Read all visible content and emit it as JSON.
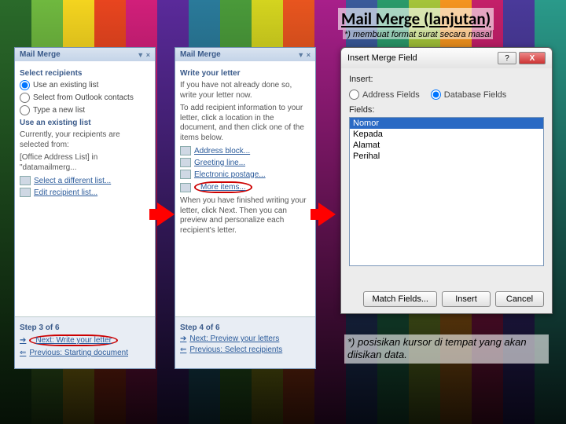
{
  "slide": {
    "title": "Mail Merge (lanjutan)",
    "subtitle": "*) membuat format surat secara masal",
    "note": "*) posisikan kursor di tempat yang akan diisikan data."
  },
  "pane1": {
    "header": "Mail Merge",
    "section_select": "Select recipients",
    "opts": {
      "existing": "Use an existing list",
      "outlook": "Select from Outlook contacts",
      "new": "Type a new list"
    },
    "section_use": "Use an existing list",
    "desc1": "Currently, your recipients are selected from:",
    "desc2": "[Office Address List] in \"datamailmerg...",
    "link_diff": "Select a different list...",
    "link_edit": "Edit recipient list...",
    "step": "Step 3 of 6",
    "next": "Next: Write your letter",
    "prev": "Previous: Starting document"
  },
  "pane2": {
    "header": "Mail Merge",
    "section_write": "Write your letter",
    "desc1": "If you have not already done so, write your letter now.",
    "desc2": "To add recipient information to your letter, click a location in the document, and then click one of the items below.",
    "items": {
      "address": "Address block...",
      "greeting": "Greeting line...",
      "postage": "Electronic postage...",
      "more": "More items..."
    },
    "desc3": "When you have finished writing your letter, click Next. Then you can preview and personalize each recipient's letter.",
    "step": "Step 4 of 6",
    "next": "Next: Preview your letters",
    "prev": "Previous: Select recipients"
  },
  "dialog": {
    "title": "Insert Merge Field",
    "insert_label": "Insert:",
    "opt_address": "Address Fields",
    "opt_database": "Database Fields",
    "fields_label": "Fields:",
    "fields": {
      "f1": "Nomor",
      "f2": "Kepada",
      "f3": "Alamat",
      "f4": "Perihal"
    },
    "btn_match": "Match Fields...",
    "btn_insert": "Insert",
    "btn_cancel": "Cancel"
  }
}
